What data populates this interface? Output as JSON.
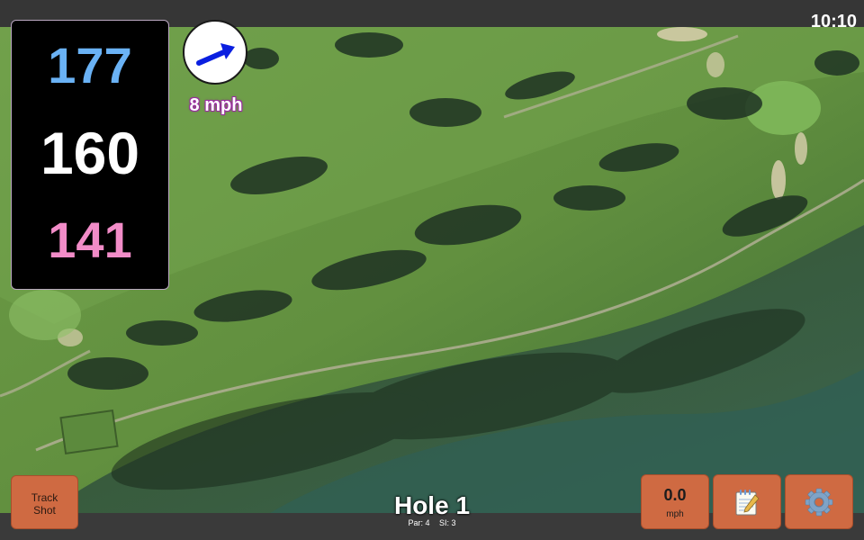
{
  "status_bar": {
    "time": "10:10"
  },
  "distances": {
    "back": "177",
    "center": "160",
    "front": "141"
  },
  "wind": {
    "speed_label": "8 mph",
    "direction_icon": "arrow-right-up-icon",
    "arrow_color": "#0a1fe0"
  },
  "hole": {
    "title": "Hole 1",
    "par_label": "Par: 4",
    "si_label": "SI: 3"
  },
  "buttons": {
    "track_line1": "Track",
    "track_line2": "Shot",
    "speed_value": "0.0",
    "speed_unit": "mph",
    "notes_icon": "notepad-icon",
    "settings_icon": "gear-icon"
  },
  "colors": {
    "back_distance": "#6ab2f5",
    "center_distance": "#ffffff",
    "front_distance": "#f28cc8",
    "button_bg": "#cf6a42"
  }
}
